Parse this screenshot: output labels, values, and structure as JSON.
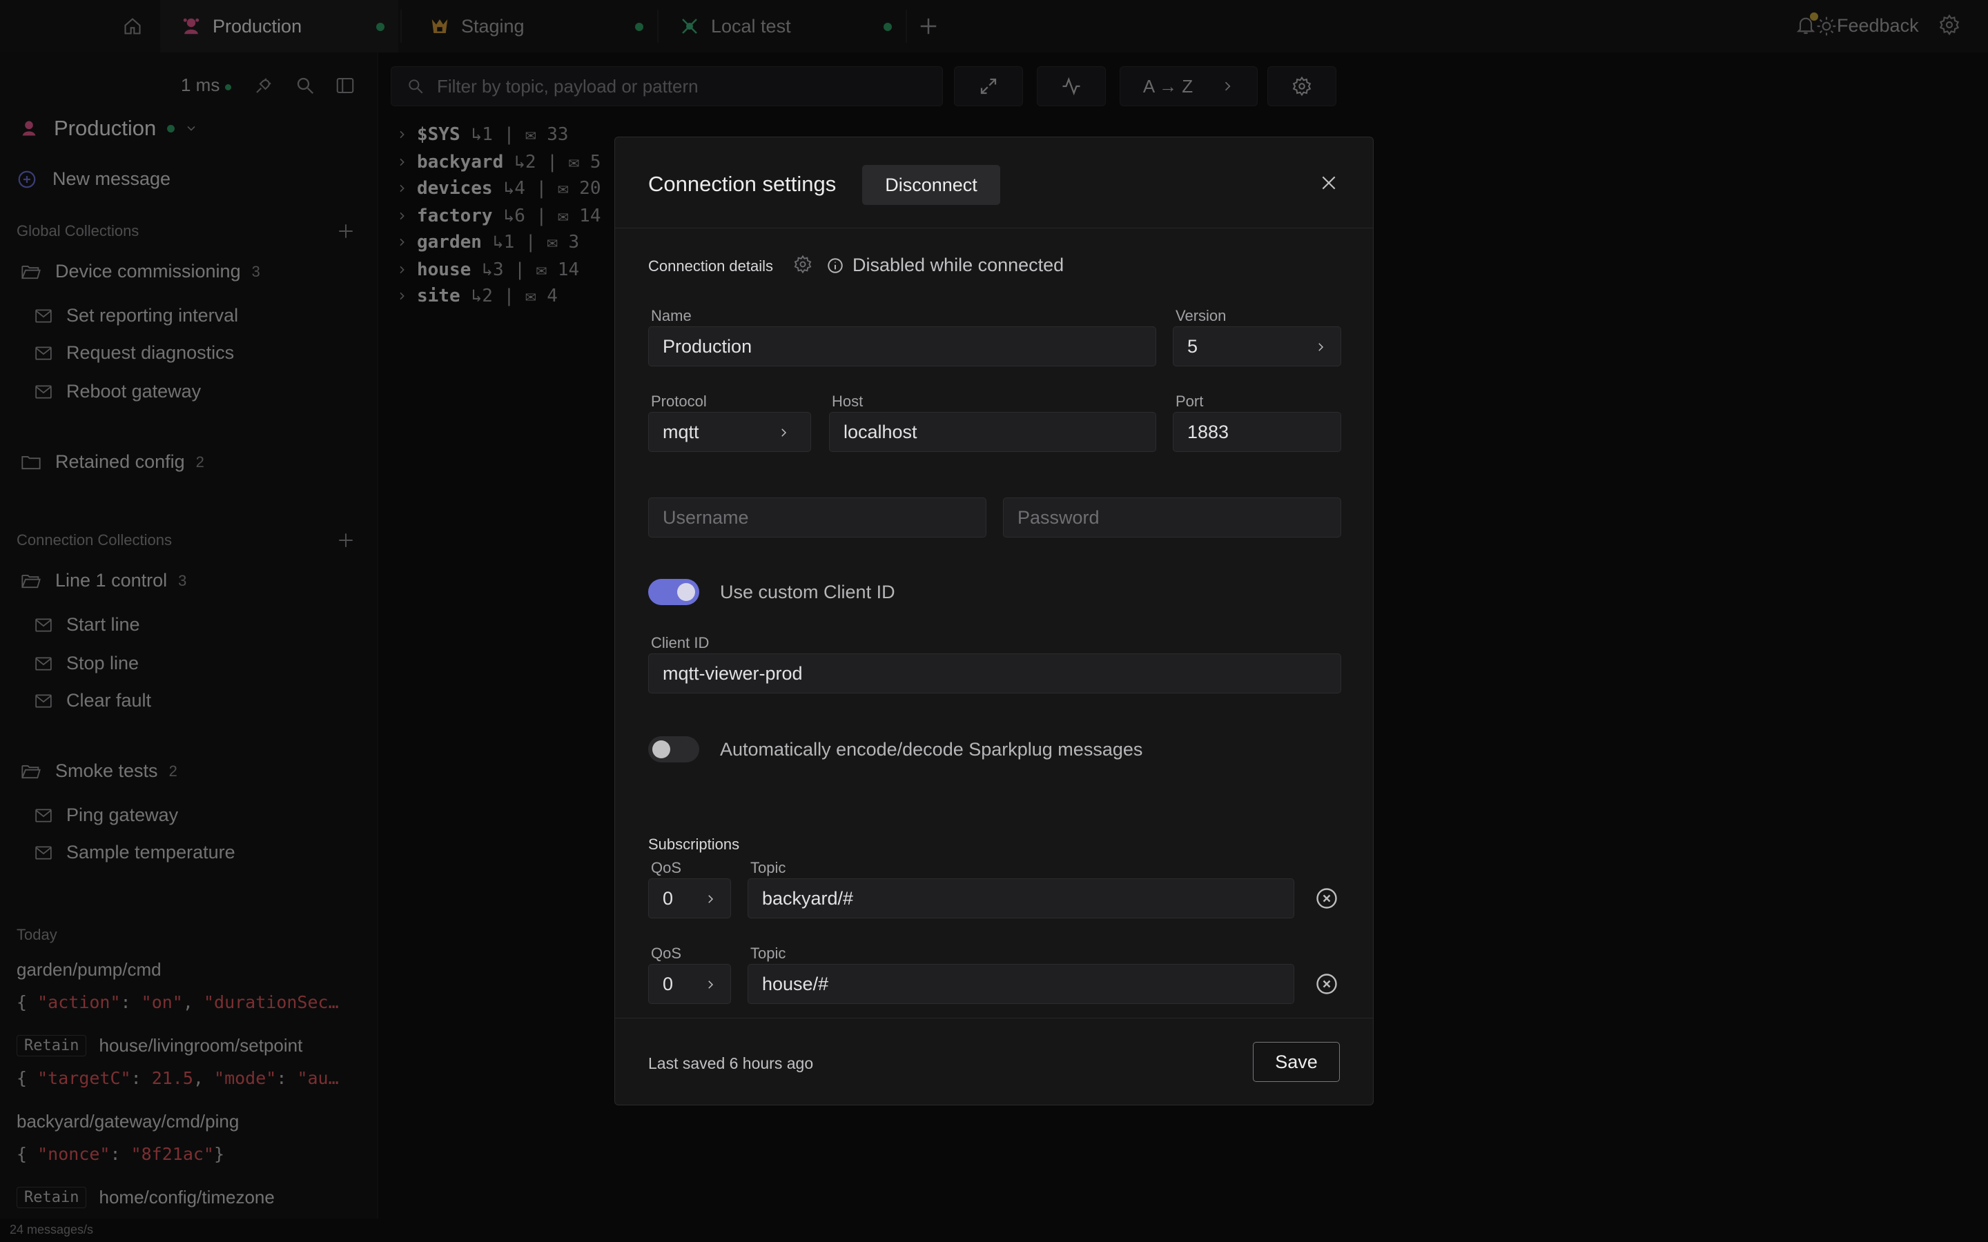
{
  "topbar": {
    "tabs": [
      {
        "label": "Production",
        "icon": "production-icon"
      },
      {
        "label": "Staging",
        "icon": "staging-icon"
      },
      {
        "label": "Local test",
        "icon": "local-test-icon"
      }
    ],
    "feedback_label": "Feedback"
  },
  "sidebar": {
    "latency": "1 ms",
    "connection_name": "Production",
    "new_message_label": "New message",
    "global_collections_label": "Global Collections",
    "global_collections": [
      {
        "label": "Device commissioning",
        "count": "3",
        "messages": [
          "Set reporting interval",
          "Request diagnostics",
          "Reboot gateway"
        ]
      },
      {
        "label": "Retained config",
        "count": "2",
        "messages": []
      }
    ],
    "connection_collections_label": "Connection Collections",
    "connection_collections": [
      {
        "label": "Line 1 control",
        "count": "3",
        "messages": [
          "Start line",
          "Stop line",
          "Clear fault"
        ]
      },
      {
        "label": "Smoke tests",
        "count": "2",
        "messages": [
          "Ping gateway",
          "Sample temperature"
        ]
      }
    ],
    "history_label": "Today",
    "history": [
      {
        "retain": "",
        "topic": "garden/pump/cmd",
        "payload": "{ \"action\": \"on\", \"durationSec…"
      },
      {
        "retain": "Retain",
        "topic": "house/livingroom/setpoint",
        "payload": "{ \"targetC\": 21.5, \"mode\": \"au…"
      },
      {
        "retain": "",
        "topic": "backyard/gateway/cmd/ping",
        "payload": "{ \"nonce\": \"8f21ac\"}"
      },
      {
        "retain": "Retain",
        "topic": "home/config/timezone",
        "payload": ""
      }
    ],
    "status": "24 messages/s"
  },
  "main": {
    "filter_placeholder": "Filter by topic, payload or pattern",
    "sort_label": "A → Z",
    "tree": [
      {
        "topic": "$SYS",
        "subtopics": "1",
        "messages": "33"
      },
      {
        "topic": "backyard",
        "subtopics": "2",
        "messages": "5"
      },
      {
        "topic": "devices",
        "subtopics": "4",
        "messages": "20"
      },
      {
        "topic": "factory",
        "subtopics": "6",
        "messages": "14"
      },
      {
        "topic": "garden",
        "subtopics": "1",
        "messages": "3"
      },
      {
        "topic": "house",
        "subtopics": "3",
        "messages": "14"
      },
      {
        "topic": "site",
        "subtopics": "2",
        "messages": "4"
      }
    ]
  },
  "modal": {
    "title": "Connection settings",
    "disconnect_label": "Disconnect",
    "connection_details_label": "Connection details",
    "disabled_note": "Disabled while connected",
    "name_label": "Name",
    "name_value": "Production",
    "version_label": "Version",
    "version_value": "5",
    "protocol_label": "Protocol",
    "protocol_value": "mqtt",
    "host_label": "Host",
    "host_value": "localhost",
    "port_label": "Port",
    "port_value": "1883",
    "username_placeholder": "Username",
    "password_placeholder": "Password",
    "custom_client_id_label": "Use custom Client ID",
    "custom_client_id_on": true,
    "client_id_label": "Client ID",
    "client_id_value": "mqtt-viewer-prod",
    "sparkplug_label": "Automatically encode/decode Sparkplug messages",
    "sparkplug_on": false,
    "subscriptions_label": "Subscriptions",
    "qos_label": "QoS",
    "topic_label": "Topic",
    "subscriptions": [
      {
        "qos": "0",
        "topic": "backyard/#"
      },
      {
        "qos": "0",
        "topic": "house/#"
      }
    ],
    "last_saved": "Last saved 6 hours ago",
    "save_label": "Save"
  },
  "colors": {
    "accent": "#6a6fd6",
    "connected": "#2f9e64",
    "string_value": "#e0565b"
  }
}
